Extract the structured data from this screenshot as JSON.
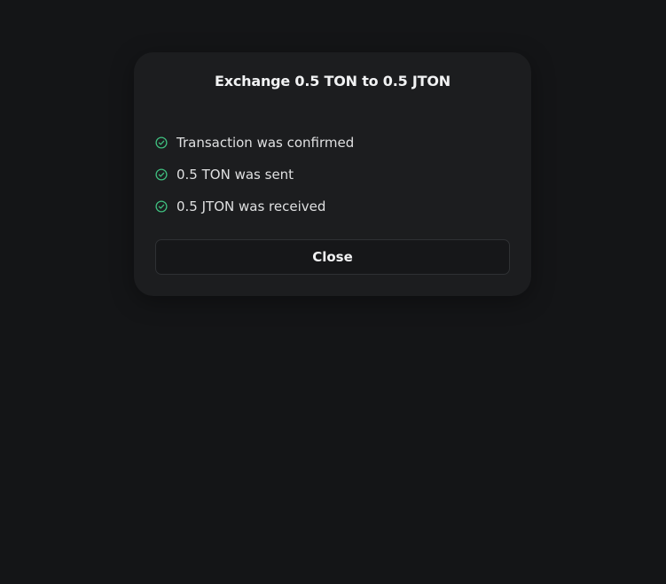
{
  "dialog": {
    "title": "Exchange 0.5 TON to 0.5 JTON",
    "status_items": [
      {
        "text": "Transaction was confirmed",
        "icon": "check-circle-icon"
      },
      {
        "text": "0.5 TON was sent",
        "icon": "check-circle-icon"
      },
      {
        "text": "0.5 JTON was received",
        "icon": "check-circle-icon"
      }
    ],
    "close_label": "Close"
  },
  "colors": {
    "background": "#141517",
    "dialog": "#1c1d1f",
    "success": "#3fbf7f",
    "text": "#e8e9ea"
  }
}
